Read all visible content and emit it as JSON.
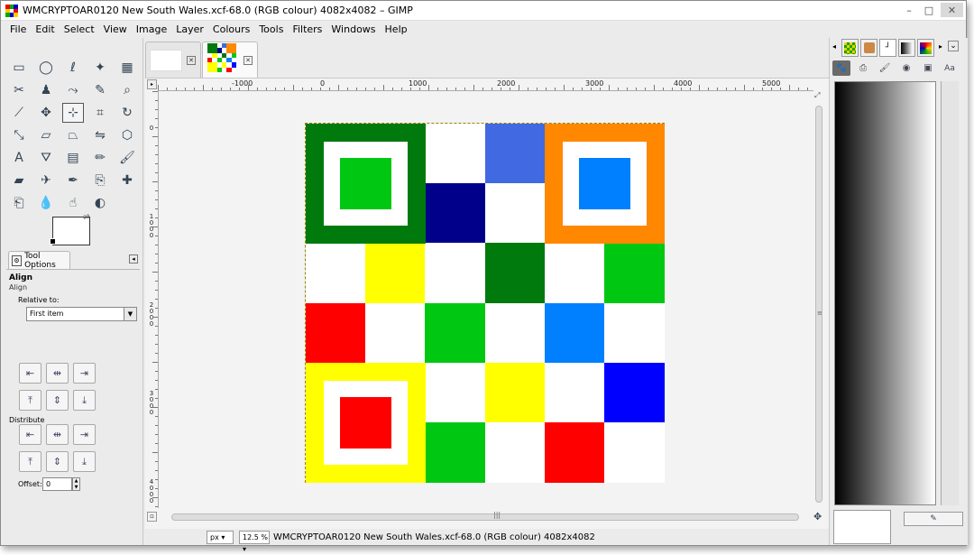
{
  "window": {
    "title": "WMCRYPTOAR0120 New South Wales.xcf-68.0 (RGB colour) 4082x4082 – GIMP",
    "minimize": "–",
    "maximize": "□",
    "close": "✕"
  },
  "menubar": {
    "items": [
      "File",
      "Edit",
      "Select",
      "View",
      "Image",
      "Layer",
      "Colours",
      "Tools",
      "Filters",
      "Windows",
      "Help"
    ]
  },
  "toolbox": {
    "tools": [
      {
        "name": "rect-select",
        "glyph": "▭"
      },
      {
        "name": "ellipse-select",
        "glyph": "◯"
      },
      {
        "name": "free-select",
        "glyph": "ℓ"
      },
      {
        "name": "fuzzy-select",
        "glyph": "✦"
      },
      {
        "name": "select-by-color",
        "glyph": "▦"
      },
      {
        "name": "scissors-select",
        "glyph": "✂"
      },
      {
        "name": "foreground-select",
        "glyph": "♟"
      },
      {
        "name": "paths",
        "glyph": "⤳"
      },
      {
        "name": "color-picker",
        "glyph": "✎"
      },
      {
        "name": "zoom",
        "glyph": "⌕"
      },
      {
        "name": "measure",
        "glyph": "⟋"
      },
      {
        "name": "move",
        "glyph": "✥"
      },
      {
        "name": "align",
        "glyph": "⊹"
      },
      {
        "name": "crop",
        "glyph": "⌗"
      },
      {
        "name": "rotate",
        "glyph": "↻"
      },
      {
        "name": "scale",
        "glyph": "⤡"
      },
      {
        "name": "shear",
        "glyph": "▱"
      },
      {
        "name": "perspective",
        "glyph": "⏢"
      },
      {
        "name": "flip",
        "glyph": "⇋"
      },
      {
        "name": "cage",
        "glyph": "⬡"
      },
      {
        "name": "text",
        "glyph": "A"
      },
      {
        "name": "bucket-fill",
        "glyph": "⛛"
      },
      {
        "name": "blend",
        "glyph": "▤"
      },
      {
        "name": "pencil",
        "glyph": "✏"
      },
      {
        "name": "paintbrush",
        "glyph": "🖌"
      },
      {
        "name": "eraser",
        "glyph": "▰"
      },
      {
        "name": "airbrush",
        "glyph": "✈"
      },
      {
        "name": "ink",
        "glyph": "✒"
      },
      {
        "name": "clone",
        "glyph": "⎘"
      },
      {
        "name": "heal",
        "glyph": "✚"
      },
      {
        "name": "perspective-clone",
        "glyph": "⎗"
      },
      {
        "name": "blur",
        "glyph": "💧"
      },
      {
        "name": "smudge",
        "glyph": "☝"
      },
      {
        "name": "dodge-burn",
        "glyph": "◐"
      }
    ],
    "fg_color": "#000000",
    "bg_color": "#ffffff"
  },
  "tool_options": {
    "tab_label": "Tool Options",
    "heading": "Align",
    "subheading": "Align",
    "relative_label": "Relative to:",
    "relative_value": "First item",
    "distribute_label": "Distribute",
    "offset_label": "Offset:",
    "offset_value": "0",
    "align_buttons": [
      {
        "name": "align-left-edge",
        "glyph": "⇤"
      },
      {
        "name": "align-center-horizontal",
        "glyph": "⇹"
      },
      {
        "name": "align-right-edge",
        "glyph": "⇥"
      },
      {
        "name": "align-top-edge",
        "glyph": "⤒"
      },
      {
        "name": "align-middle-vertical",
        "glyph": "⇕"
      },
      {
        "name": "align-bottom-edge",
        "glyph": "⤓"
      }
    ],
    "distribute_buttons": [
      {
        "name": "distribute-left-edges",
        "glyph": "⇤"
      },
      {
        "name": "distribute-centers-horizontal",
        "glyph": "⇹"
      },
      {
        "name": "distribute-right-edges",
        "glyph": "⇥"
      },
      {
        "name": "distribute-top-edges",
        "glyph": "⤒"
      },
      {
        "name": "distribute-centers-vertical",
        "glyph": "⇕"
      },
      {
        "name": "distribute-bottom-edges",
        "glyph": "⤓"
      }
    ]
  },
  "image_window": {
    "hruler_labels": [
      "-1000",
      "0",
      "1000",
      "2000",
      "3000",
      "4000",
      "5000"
    ],
    "vruler_labels": [
      "0",
      "1000",
      "2000",
      "3000",
      "4000"
    ],
    "unit": "px",
    "zoom": "12.5 %",
    "status": "WMCRYPTOAR0120 New South Wales.xcf-68.0 (RGB colour) 4082x4082"
  },
  "image_tabs": [
    {
      "label": "blank image"
    },
    {
      "label": "current image"
    }
  ],
  "checkerboard": {
    "rows": [
      [
        "#007a0c",
        "#007a0c",
        "#ffffff",
        "#4169e1",
        "#ff8800",
        "#ff8800"
      ],
      [
        "#007a0c",
        "#007a0c",
        "#00008b",
        "#ffffff",
        "#ff8800",
        "#ff8800"
      ],
      [
        "#ffffff",
        "#ffff00",
        "#ffffff",
        "#007a0c",
        "#ffffff",
        "#00c812"
      ],
      [
        "#ff0000",
        "#ffffff",
        "#00c812",
        "#ffffff",
        "#0080ff",
        "#ffffff"
      ],
      [
        "#ffff00",
        "#ffff00",
        "#ffffff",
        "#ffff00",
        "#ffffff",
        "#0000ff"
      ],
      [
        "#ffff00",
        "#ffff00",
        "#00c812",
        "#ffffff",
        "#ff0000",
        "#ffffff"
      ]
    ],
    "big_squares": [
      {
        "row": 0,
        "col": 0,
        "outer": "#007a0c",
        "inner": "#00c812"
      },
      {
        "row": 0,
        "col": 4,
        "outer": "#ff8800",
        "inner": "#0080ff"
      },
      {
        "row": 4,
        "col": 0,
        "outer": "#ffff00",
        "inner": "#ff0000"
      }
    ]
  },
  "dock": {
    "tabs": [
      "patterns",
      "brushes",
      "paths",
      "gradients",
      "palettes"
    ],
    "subtabs": [
      "layers-icon",
      "channels-icon",
      "paint-icon",
      "colors-icon",
      "swatches-icon",
      "fonts-icon"
    ]
  }
}
